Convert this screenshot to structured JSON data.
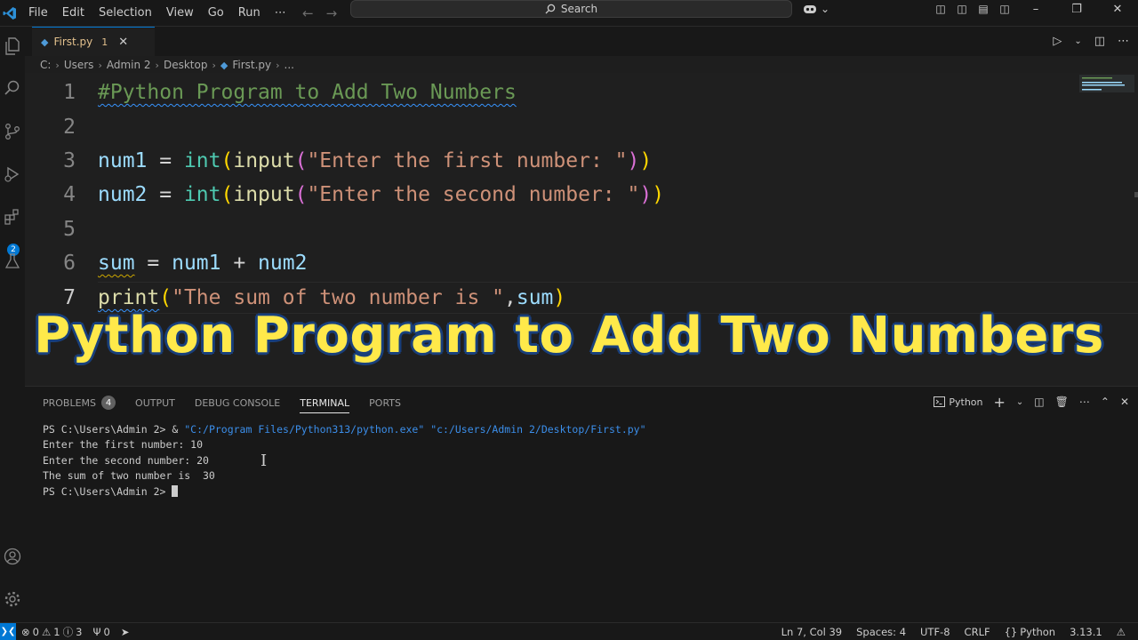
{
  "window": {
    "menu": [
      "File",
      "Edit",
      "Selection",
      "View",
      "Go",
      "Run",
      "⋯"
    ],
    "search_label": "Search"
  },
  "tab": {
    "label": "First.py",
    "modified_count": "1"
  },
  "breadcrumb": [
    "C:",
    "Users",
    "Admin 2",
    "Desktop",
    "First.py",
    "..."
  ],
  "editor": {
    "line_numbers": [
      "1",
      "2",
      "3",
      "4",
      "5",
      "6",
      "7"
    ],
    "lines": {
      "l1": {
        "comment": "#Python Program to Add Two Numbers"
      },
      "l3": {
        "var": "num1",
        "eq": " = ",
        "builtin": "int",
        "p1": "(",
        "func": "input",
        "p2": "(",
        "str": "\"Enter the first number: \"",
        "p3": ")",
        "p4": ")"
      },
      "l4": {
        "var": "num2",
        "eq": " = ",
        "builtin": "int",
        "p1": "(",
        "func": "input",
        "p2": "(",
        "str": "\"Enter the second number: \"",
        "p3": ")",
        "p4": ")"
      },
      "l6": {
        "var": "sum",
        "eq": " = ",
        "a": "num1",
        "plus": " + ",
        "b": "num2"
      },
      "l7": {
        "func": "print",
        "p1": "(",
        "str": "\"The sum of two number is \"",
        "comma": ",",
        "var": "sum",
        "p2": ")"
      }
    }
  },
  "overlay_title": "Python Program to Add Two Numbers",
  "panel": {
    "tabs": [
      {
        "label": "PROBLEMS",
        "badge": "4"
      },
      {
        "label": "OUTPUT"
      },
      {
        "label": "DEBUG CONSOLE"
      },
      {
        "label": "TERMINAL",
        "active": true
      },
      {
        "label": "PORTS"
      }
    ],
    "terminal_profile": "Python"
  },
  "terminal": {
    "cmd_prompt": "PS C:\\Users\\Admin 2> & ",
    "cmd_path": "\"C:/Program Files/Python313/python.exe\" \"c:/Users/Admin 2/Desktop/First.py\"",
    "line2": "Enter the first number: 10",
    "line3": "Enter the second number: 20",
    "line4": "The sum of two number is  30",
    "line5": "PS C:\\Users\\Admin 2> "
  },
  "statusbar": {
    "errors": "0",
    "warnings": "1",
    "info": "3",
    "ports": "0",
    "position": "Ln 7, Col 39",
    "spaces": "Spaces: 4",
    "encoding": "UTF-8",
    "eol": "CRLF",
    "language": "Python",
    "version": "3.13.1"
  },
  "colors": {
    "accent": "#0078d4",
    "headline": "#ffe94a",
    "headline_outline": "#1a3f7a"
  },
  "icons": [
    "vscode-logo-icon",
    "files-icon",
    "search-icon",
    "source-control-icon",
    "run-debug-icon",
    "extensions-icon",
    "testing-icon",
    "account-icon",
    "settings-gear-icon",
    "copilot-icon",
    "python-file-icon",
    "play-icon",
    "split-editor-icon",
    "more-icon",
    "terminal-icon",
    "plus-icon",
    "trash-icon",
    "maximize-icon",
    "close-icon"
  ]
}
